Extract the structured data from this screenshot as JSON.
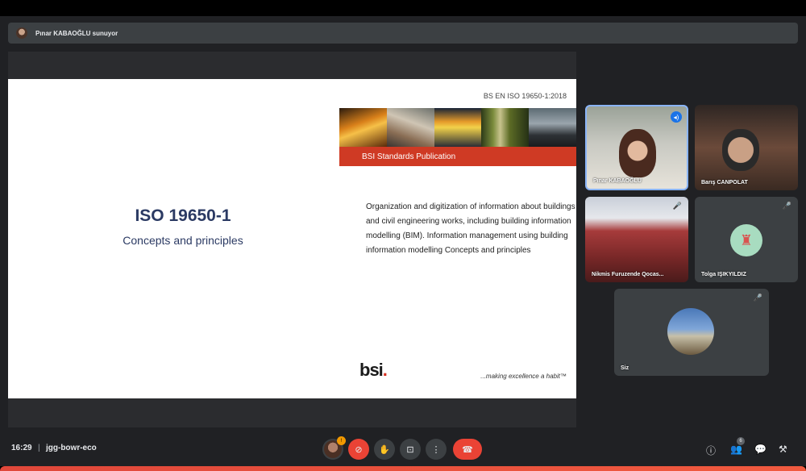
{
  "presenter": {
    "text": "Pınar KABAOĞLU sunuyor"
  },
  "slide": {
    "code": "BS EN ISO 19650-1:2018",
    "banner_label": "BSI Standards Publication",
    "title": "ISO 19650-1",
    "subtitle": "Concepts and principles",
    "description": "Organization and digitization of information about buildings and civil engineering works, including building information modelling (BIM). Information management using building information modelling Concepts and principles",
    "logo_text": "bsi",
    "logo_dot": ".",
    "tagline": "...making excellence a habit™"
  },
  "participants": [
    {
      "name": "Pınar KABAOĞLU",
      "state": "speaking"
    },
    {
      "name": "Barış CANPOLAT",
      "state": "video"
    },
    {
      "name": "Nikmis Furuzende Qocas...",
      "state": "video"
    },
    {
      "name": "Tolga IŞIKYILDIZ",
      "state": "mic-off"
    },
    {
      "name": "Siz",
      "state": "mic-off"
    }
  ],
  "bottom": {
    "time": "16:29",
    "separator": "|",
    "meeting_code": "jgg-bowr-eco",
    "people_count": "6",
    "avatar_badge": "!"
  },
  "icons": {
    "mic_off": "🎤",
    "camera_off": "⊘",
    "hand": "✋",
    "present": "⊡",
    "more": "⋮",
    "end_call": "☎",
    "info": "ⓘ",
    "people": "👥",
    "chat": "💬",
    "activities": "⚒",
    "speaking": "◂)"
  },
  "colors": {
    "accent": "#1a73e8",
    "end_call": "#ea4335",
    "slide_title": "#2b3a63",
    "banner_red": "#cf3a24"
  }
}
